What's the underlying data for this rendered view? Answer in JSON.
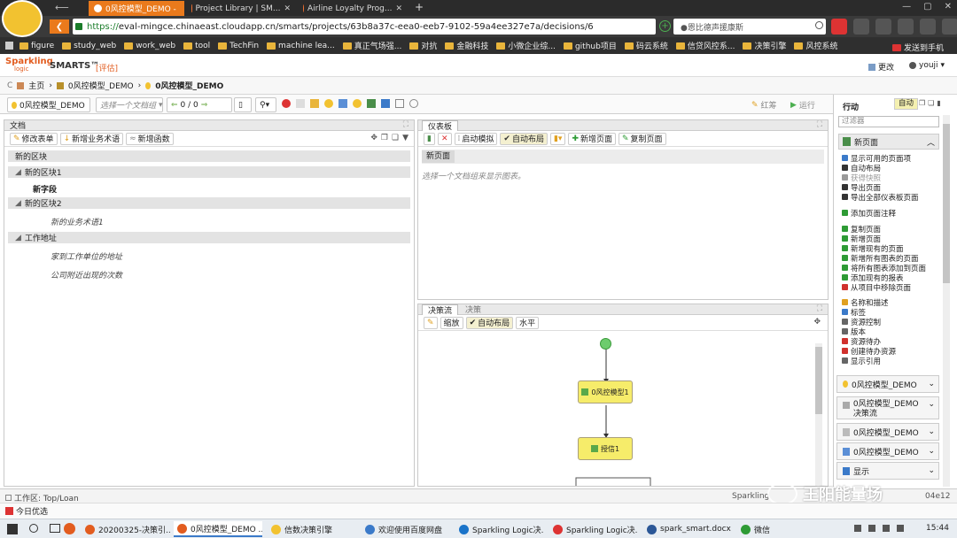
{
  "browser": {
    "tabs": [
      {
        "title": "0风控模型_DEMO -"
      },
      {
        "title": "Project Library | SM..."
      },
      {
        "title": "Airline Loyalty Prog..."
      }
    ],
    "new_tab": "+",
    "url_scheme": "https://",
    "url_rest": "eval-mingce.chinaeast.cloudapp.cn/smarts/projects/63b8a37c-eea0-eeb7-9102-59a4ee327e7a/decisions/6",
    "search_placeholder": "●恩比德声援康斯",
    "bookmarks": [
      "figure",
      "study_web",
      "work_web",
      "tool",
      "TechFin",
      "machine lea...",
      "真正气场强...",
      "对抗",
      "金融科技",
      "小微企业综...",
      "github项目",
      "码云系统",
      "信贷风控系...",
      "决策引擎",
      "风控系统"
    ],
    "send_to_phone": "发送到手机"
  },
  "app": {
    "logo_top": "Sparkling",
    "logo_bottom": "logic",
    "product": "SMARTS™",
    "edition": "[评估]",
    "change": "更改",
    "user": "youji",
    "breadcrumb": [
      "主页",
      "0风控模型_DEMO",
      "0风控模型_DEMO"
    ],
    "toolbar": {
      "project": "0风控模型_DEMO",
      "doc_placeholder": "选择一个文档组",
      "counter": "0 / 0",
      "redo": "红筹",
      "run": "运行"
    }
  },
  "docs_panel": {
    "title": "文档",
    "buttons": [
      "修改表单",
      "新增业务术语",
      "新增函数"
    ],
    "sections": [
      {
        "label": "新的区块",
        "items": []
      },
      {
        "label": "新的区块1",
        "items": [
          {
            "text": "新字段",
            "bold": true
          }
        ]
      },
      {
        "label": "新的区块2",
        "items": [
          {
            "text": "新的业务术语1",
            "bold": false
          }
        ]
      },
      {
        "label": "工作地址",
        "items": [
          {
            "text": "家到工作单位的地址",
            "bold": false
          },
          {
            "text": "公司附近出现的次数",
            "bold": false
          }
        ]
      }
    ]
  },
  "dashboard_panel": {
    "title": "仪表板",
    "buttons": [
      "启动模拟",
      "自动布局",
      "新增页面",
      "复制页面"
    ],
    "page_tab": "新页面",
    "hint": "选择一个文档组来显示图表。"
  },
  "flow_panel": {
    "tabs": [
      "决策流",
      "决策"
    ],
    "buttons": [
      "缩放",
      "自动布局",
      "水平"
    ],
    "nodes": [
      "0风控模型1",
      "授信1"
    ]
  },
  "actions_panel": {
    "title": "行动",
    "auto": "自动",
    "filter_placeholder": "过滤器",
    "group": "新页面",
    "items": [
      {
        "label": "显示可用的页面项",
        "color": "#3b7ac9"
      },
      {
        "label": "自动布局",
        "color": "#333333"
      },
      {
        "label": "获得快照",
        "color": "#9a9a9a"
      },
      {
        "label": "导出页面",
        "color": "#333333"
      },
      {
        "label": "导出全部仪表板页面",
        "color": "#333333"
      },
      {
        "label": "添加页面注释",
        "color": "#2e9b35"
      },
      {
        "label": "复制页面",
        "color": "#2e9b35"
      },
      {
        "label": "新增页面",
        "color": "#2e9b35"
      },
      {
        "label": "新增现有的页面",
        "color": "#2e9b35"
      },
      {
        "label": "新增所有图表的页面",
        "color": "#2e9b35"
      },
      {
        "label": "将所有图表添加到页面",
        "color": "#2e9b35"
      },
      {
        "label": "添加现有的报表",
        "color": "#2e9b35"
      },
      {
        "label": "从项目中移除页面",
        "color": "#d0312d"
      },
      {
        "label": "名称和描述",
        "color": "#e0a020"
      },
      {
        "label": "标签",
        "color": "#3b7ac9"
      },
      {
        "label": "资源控制",
        "color": "#666666"
      },
      {
        "label": "版本",
        "color": "#666666"
      },
      {
        "label": "资源待办",
        "color": "#d0312d"
      },
      {
        "label": "创建待办资源",
        "color": "#d0312d"
      },
      {
        "label": "显示引用",
        "color": "#666666"
      }
    ],
    "collapsed": [
      "0风控模型_DEMO",
      "0风控模型_DEMO 决策流",
      "0风控模型_DEMO",
      "0风控模型_DEMO",
      "显示"
    ]
  },
  "status_bar": {
    "workspace": "工作区: Top/Loan",
    "brand": "Sparkling",
    "version": "04e12",
    "watermark": "王阳能量场"
  },
  "note_tab": "今日优选",
  "taskbar": {
    "tasks": [
      "20200325-决策引...",
      "0风控模型_DEMO ...",
      "信数决策引擎",
      "欢迎使用百度网盘",
      "Sparkling Logic决...",
      "Sparkling Logic决...",
      "spark_smart.docx ...",
      "微信"
    ],
    "time": "15:44"
  },
  "colors": {
    "accent": "#ea7a1c",
    "node_fill": "#f6ec6a",
    "start_node": "#6dcc6d"
  }
}
